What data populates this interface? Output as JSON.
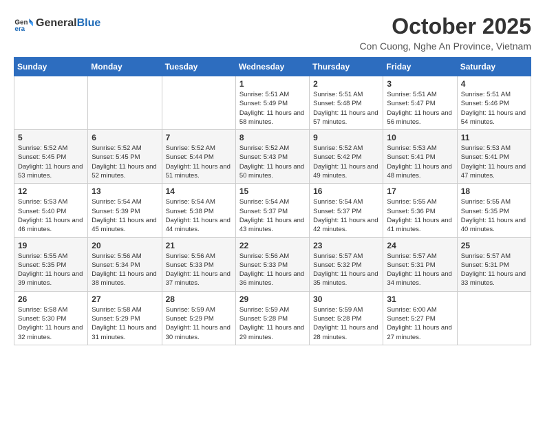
{
  "header": {
    "logo_general": "General",
    "logo_blue": "Blue",
    "month": "October 2025",
    "location": "Con Cuong, Nghe An Province, Vietnam"
  },
  "weekdays": [
    "Sunday",
    "Monday",
    "Tuesday",
    "Wednesday",
    "Thursday",
    "Friday",
    "Saturday"
  ],
  "weeks": [
    [
      {
        "day": "",
        "sunrise": "",
        "sunset": "",
        "daylight": ""
      },
      {
        "day": "",
        "sunrise": "",
        "sunset": "",
        "daylight": ""
      },
      {
        "day": "",
        "sunrise": "",
        "sunset": "",
        "daylight": ""
      },
      {
        "day": "1",
        "sunrise": "Sunrise: 5:51 AM",
        "sunset": "Sunset: 5:49 PM",
        "daylight": "Daylight: 11 hours and 58 minutes."
      },
      {
        "day": "2",
        "sunrise": "Sunrise: 5:51 AM",
        "sunset": "Sunset: 5:48 PM",
        "daylight": "Daylight: 11 hours and 57 minutes."
      },
      {
        "day": "3",
        "sunrise": "Sunrise: 5:51 AM",
        "sunset": "Sunset: 5:47 PM",
        "daylight": "Daylight: 11 hours and 56 minutes."
      },
      {
        "day": "4",
        "sunrise": "Sunrise: 5:51 AM",
        "sunset": "Sunset: 5:46 PM",
        "daylight": "Daylight: 11 hours and 54 minutes."
      }
    ],
    [
      {
        "day": "5",
        "sunrise": "Sunrise: 5:52 AM",
        "sunset": "Sunset: 5:45 PM",
        "daylight": "Daylight: 11 hours and 53 minutes."
      },
      {
        "day": "6",
        "sunrise": "Sunrise: 5:52 AM",
        "sunset": "Sunset: 5:45 PM",
        "daylight": "Daylight: 11 hours and 52 minutes."
      },
      {
        "day": "7",
        "sunrise": "Sunrise: 5:52 AM",
        "sunset": "Sunset: 5:44 PM",
        "daylight": "Daylight: 11 hours and 51 minutes."
      },
      {
        "day": "8",
        "sunrise": "Sunrise: 5:52 AM",
        "sunset": "Sunset: 5:43 PM",
        "daylight": "Daylight: 11 hours and 50 minutes."
      },
      {
        "day": "9",
        "sunrise": "Sunrise: 5:52 AM",
        "sunset": "Sunset: 5:42 PM",
        "daylight": "Daylight: 11 hours and 49 minutes."
      },
      {
        "day": "10",
        "sunrise": "Sunrise: 5:53 AM",
        "sunset": "Sunset: 5:41 PM",
        "daylight": "Daylight: 11 hours and 48 minutes."
      },
      {
        "day": "11",
        "sunrise": "Sunrise: 5:53 AM",
        "sunset": "Sunset: 5:41 PM",
        "daylight": "Daylight: 11 hours and 47 minutes."
      }
    ],
    [
      {
        "day": "12",
        "sunrise": "Sunrise: 5:53 AM",
        "sunset": "Sunset: 5:40 PM",
        "daylight": "Daylight: 11 hours and 46 minutes."
      },
      {
        "day": "13",
        "sunrise": "Sunrise: 5:54 AM",
        "sunset": "Sunset: 5:39 PM",
        "daylight": "Daylight: 11 hours and 45 minutes."
      },
      {
        "day": "14",
        "sunrise": "Sunrise: 5:54 AM",
        "sunset": "Sunset: 5:38 PM",
        "daylight": "Daylight: 11 hours and 44 minutes."
      },
      {
        "day": "15",
        "sunrise": "Sunrise: 5:54 AM",
        "sunset": "Sunset: 5:37 PM",
        "daylight": "Daylight: 11 hours and 43 minutes."
      },
      {
        "day": "16",
        "sunrise": "Sunrise: 5:54 AM",
        "sunset": "Sunset: 5:37 PM",
        "daylight": "Daylight: 11 hours and 42 minutes."
      },
      {
        "day": "17",
        "sunrise": "Sunrise: 5:55 AM",
        "sunset": "Sunset: 5:36 PM",
        "daylight": "Daylight: 11 hours and 41 minutes."
      },
      {
        "day": "18",
        "sunrise": "Sunrise: 5:55 AM",
        "sunset": "Sunset: 5:35 PM",
        "daylight": "Daylight: 11 hours and 40 minutes."
      }
    ],
    [
      {
        "day": "19",
        "sunrise": "Sunrise: 5:55 AM",
        "sunset": "Sunset: 5:35 PM",
        "daylight": "Daylight: 11 hours and 39 minutes."
      },
      {
        "day": "20",
        "sunrise": "Sunrise: 5:56 AM",
        "sunset": "Sunset: 5:34 PM",
        "daylight": "Daylight: 11 hours and 38 minutes."
      },
      {
        "day": "21",
        "sunrise": "Sunrise: 5:56 AM",
        "sunset": "Sunset: 5:33 PM",
        "daylight": "Daylight: 11 hours and 37 minutes."
      },
      {
        "day": "22",
        "sunrise": "Sunrise: 5:56 AM",
        "sunset": "Sunset: 5:33 PM",
        "daylight": "Daylight: 11 hours and 36 minutes."
      },
      {
        "day": "23",
        "sunrise": "Sunrise: 5:57 AM",
        "sunset": "Sunset: 5:32 PM",
        "daylight": "Daylight: 11 hours and 35 minutes."
      },
      {
        "day": "24",
        "sunrise": "Sunrise: 5:57 AM",
        "sunset": "Sunset: 5:31 PM",
        "daylight": "Daylight: 11 hours and 34 minutes."
      },
      {
        "day": "25",
        "sunrise": "Sunrise: 5:57 AM",
        "sunset": "Sunset: 5:31 PM",
        "daylight": "Daylight: 11 hours and 33 minutes."
      }
    ],
    [
      {
        "day": "26",
        "sunrise": "Sunrise: 5:58 AM",
        "sunset": "Sunset: 5:30 PM",
        "daylight": "Daylight: 11 hours and 32 minutes."
      },
      {
        "day": "27",
        "sunrise": "Sunrise: 5:58 AM",
        "sunset": "Sunset: 5:29 PM",
        "daylight": "Daylight: 11 hours and 31 minutes."
      },
      {
        "day": "28",
        "sunrise": "Sunrise: 5:59 AM",
        "sunset": "Sunset: 5:29 PM",
        "daylight": "Daylight: 11 hours and 30 minutes."
      },
      {
        "day": "29",
        "sunrise": "Sunrise: 5:59 AM",
        "sunset": "Sunset: 5:28 PM",
        "daylight": "Daylight: 11 hours and 29 minutes."
      },
      {
        "day": "30",
        "sunrise": "Sunrise: 5:59 AM",
        "sunset": "Sunset: 5:28 PM",
        "daylight": "Daylight: 11 hours and 28 minutes."
      },
      {
        "day": "31",
        "sunrise": "Sunrise: 6:00 AM",
        "sunset": "Sunset: 5:27 PM",
        "daylight": "Daylight: 11 hours and 27 minutes."
      },
      {
        "day": "",
        "sunrise": "",
        "sunset": "",
        "daylight": ""
      }
    ]
  ]
}
